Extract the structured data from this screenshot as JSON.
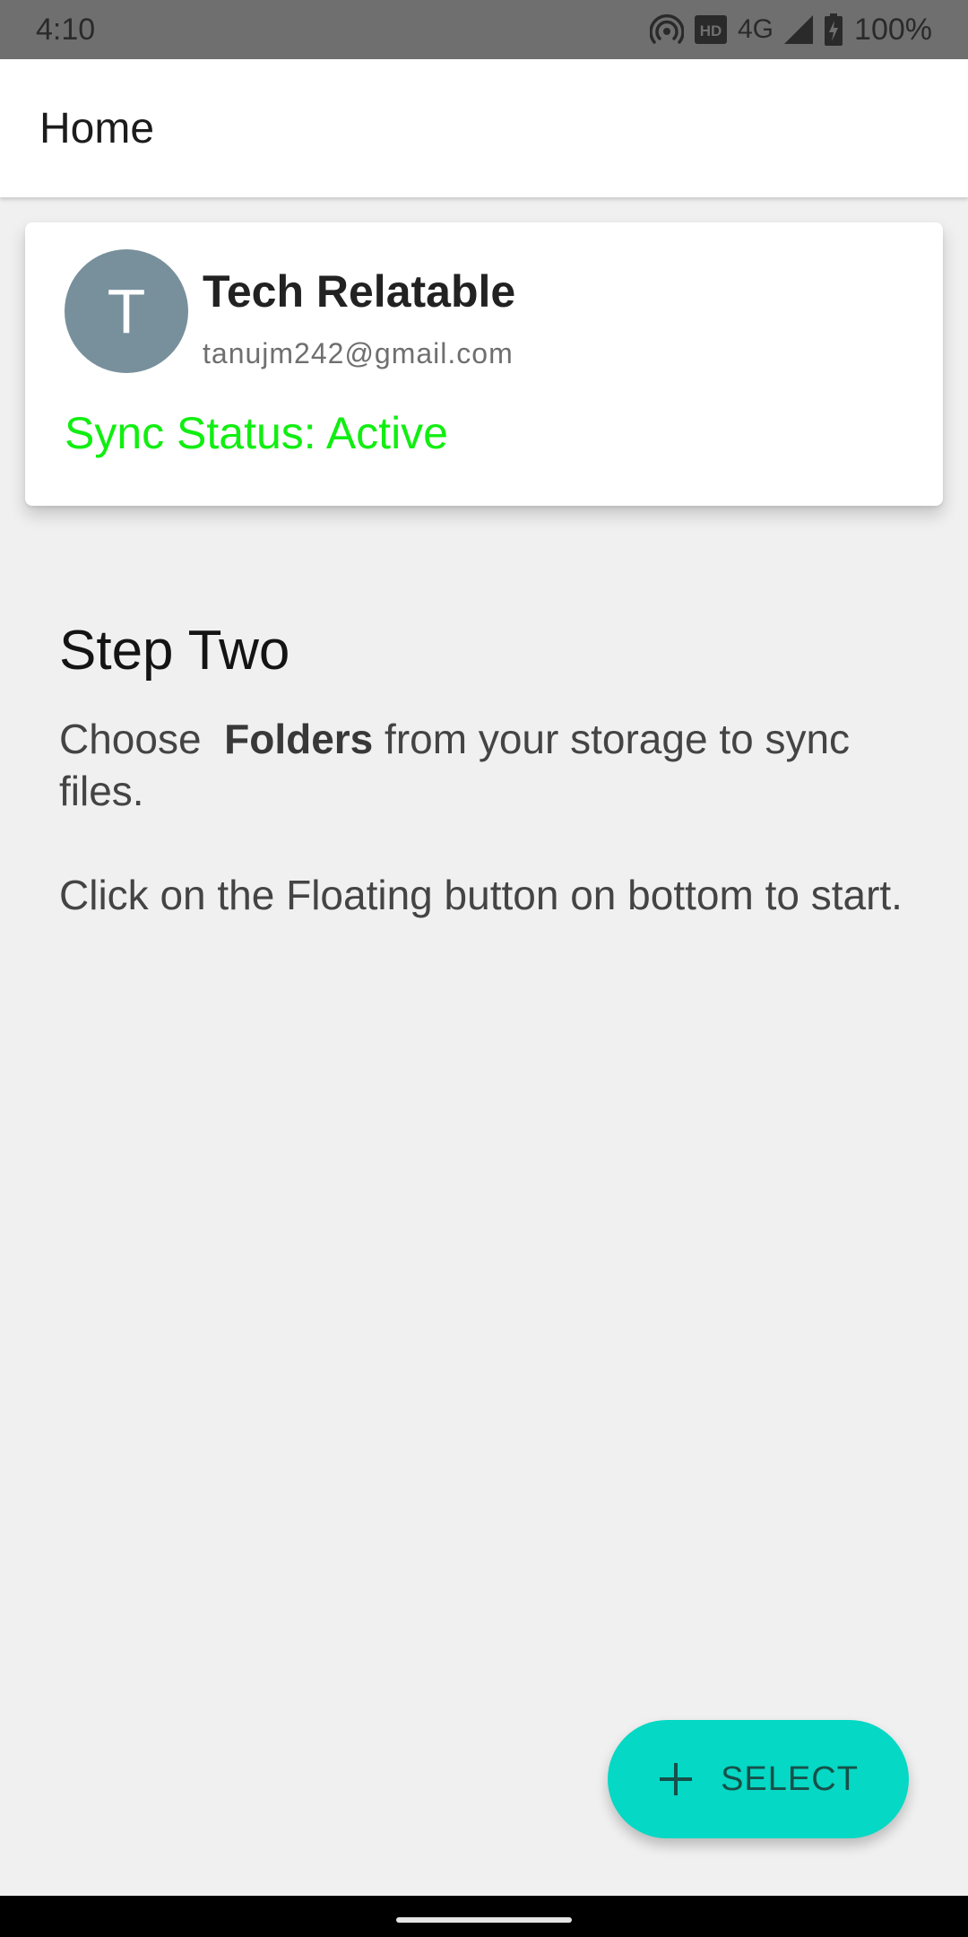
{
  "status_bar": {
    "time": "4:10",
    "network": "4G",
    "battery_percent": "100%",
    "icons": [
      "hotspot-icon",
      "hd-icon",
      "signal-icon",
      "battery-charging-icon"
    ]
  },
  "app_bar": {
    "title": "Home"
  },
  "profile": {
    "avatar_letter": "T",
    "avatar_color": "#78909c",
    "name": "Tech Relatable",
    "email": "tanujm242@gmail.com",
    "sync_status": "Sync Status: Active",
    "sync_status_color": "#11ee11"
  },
  "step": {
    "heading": "Step Two",
    "line1_before": "Choose  ",
    "line1_bold": "Folders",
    "line1_after": " from your storage to sync files.",
    "line2": "Click on the Floating button on bottom to start."
  },
  "fab": {
    "label": "SELECT",
    "icon": "plus-icon",
    "color": "#05d8c4"
  },
  "colors": {
    "status_bar_bg": "#6f6f6f",
    "page_bg": "#f0f0f0"
  }
}
